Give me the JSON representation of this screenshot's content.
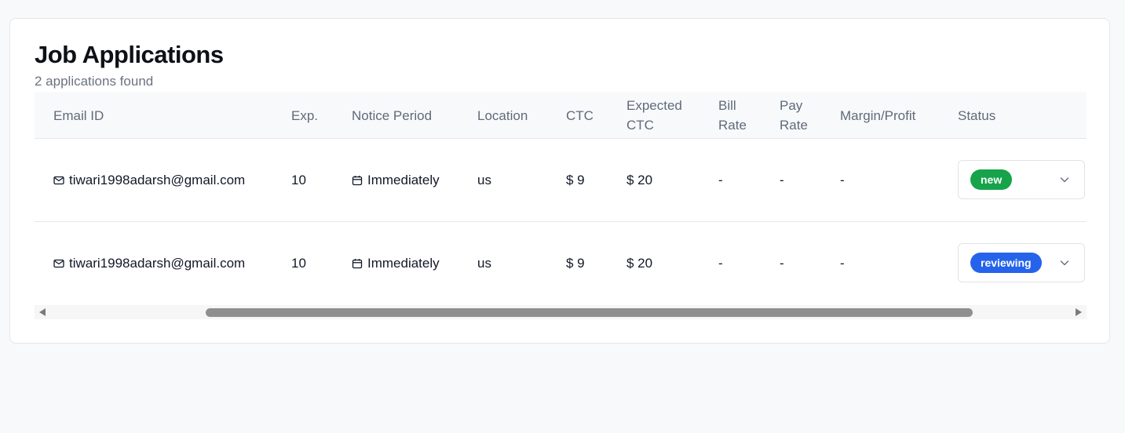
{
  "header": {
    "title": "Job Applications",
    "subtitle": "2 applications found"
  },
  "table": {
    "columns": {
      "email": "Email ID",
      "exp": "Exp.",
      "notice": "Notice Period",
      "location": "Location",
      "ctc": "CTC",
      "expected_ctc_1": "Expected",
      "expected_ctc_2": "CTC",
      "bill_rate_1": "Bill",
      "bill_rate_2": "Rate",
      "pay_rate_1": "Pay",
      "pay_rate_2": "Rate",
      "margin": "Margin/Profit",
      "status": "Status"
    },
    "rows": [
      {
        "email": "tiwari1998adarsh@gmail.com",
        "exp": "10",
        "notice": "Immediately",
        "location": "us",
        "ctc": "$ 9",
        "expected_ctc": "$ 20",
        "bill_rate": "-",
        "pay_rate": "-",
        "margin": "-",
        "status": "new",
        "status_color": "#16a34a"
      },
      {
        "email": "tiwari1998adarsh@gmail.com",
        "exp": "10",
        "notice": "Immediately",
        "location": "us",
        "ctc": "$ 9",
        "expected_ctc": "$ 20",
        "bill_rate": "-",
        "pay_rate": "-",
        "margin": "-",
        "status": "reviewing",
        "status_color": "#2563eb"
      }
    ]
  },
  "icons": {
    "email": "mail-icon",
    "notice": "calendar-icon",
    "status_dropdown": "chevron-down-icon"
  },
  "colors": {
    "status_new": "#16a34a",
    "status_reviewing": "#2563eb",
    "muted_text": "#6b7280"
  }
}
